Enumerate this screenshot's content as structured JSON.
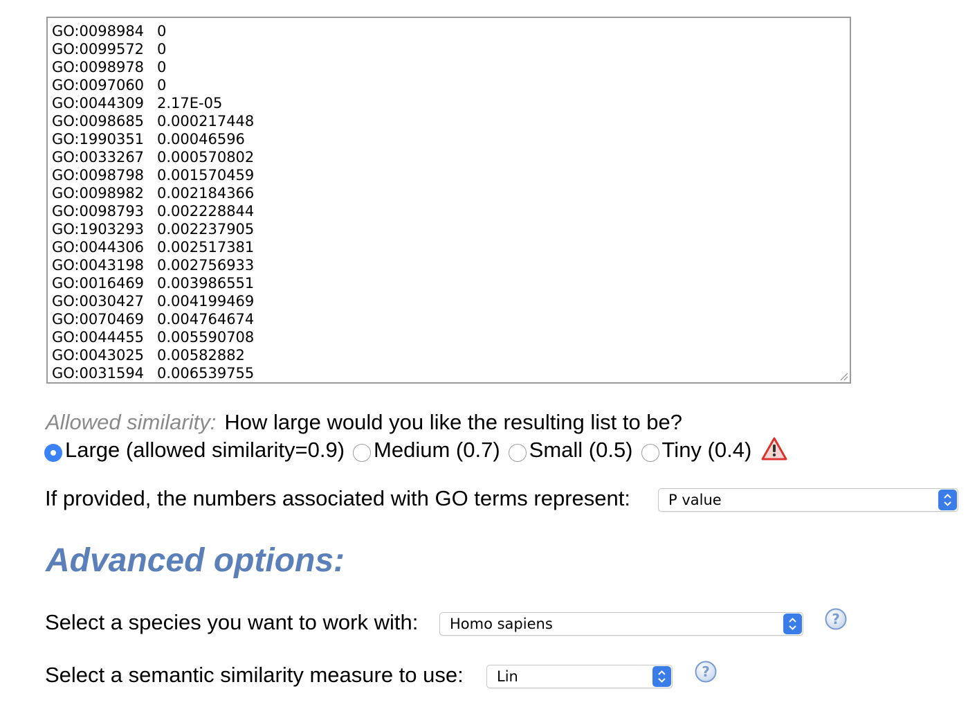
{
  "go_list": {
    "rows": [
      {
        "id": "GO:0098984",
        "value": "0"
      },
      {
        "id": "GO:0099572",
        "value": "0"
      },
      {
        "id": "GO:0098978",
        "value": "0"
      },
      {
        "id": "GO:0097060",
        "value": "0"
      },
      {
        "id": "GO:0044309",
        "value": "2.17E-05"
      },
      {
        "id": "GO:0098685",
        "value": "0.000217448"
      },
      {
        "id": "GO:1990351",
        "value": "0.00046596"
      },
      {
        "id": "GO:0033267",
        "value": "0.000570802"
      },
      {
        "id": "GO:0098798",
        "value": "0.001570459"
      },
      {
        "id": "GO:0098982",
        "value": "0.002184366"
      },
      {
        "id": "GO:0098793",
        "value": "0.002228844"
      },
      {
        "id": "GO:1903293",
        "value": "0.002237905"
      },
      {
        "id": "GO:0044306",
        "value": "0.002517381"
      },
      {
        "id": "GO:0043198",
        "value": "0.002756933"
      },
      {
        "id": "GO:0016469",
        "value": "0.003986551"
      },
      {
        "id": "GO:0030427",
        "value": "0.004199469"
      },
      {
        "id": "GO:0070469",
        "value": "0.004764674"
      },
      {
        "id": "GO:0044455",
        "value": "0.005590708"
      },
      {
        "id": "GO:0043025",
        "value": "0.00582882"
      },
      {
        "id": "GO:0031594",
        "value": "0.006539755"
      }
    ]
  },
  "similarity": {
    "label": "Allowed similarity:",
    "question": "How large would you like the resulting list to be?",
    "options": [
      {
        "label": "Large (allowed similarity=0.9)",
        "checked": true
      },
      {
        "label": "Medium (0.7)",
        "checked": false
      },
      {
        "label": "Small (0.5)",
        "checked": false
      },
      {
        "label": "Tiny (0.4)",
        "checked": false
      }
    ],
    "warning_icon": "warning-triangle-icon"
  },
  "numbers_represent": {
    "label": "If provided, the numbers associated with GO terms represent:",
    "selected": "P value"
  },
  "advanced": {
    "heading": "Advanced options:"
  },
  "species": {
    "label": "Select a species you want to work with:",
    "selected": "Homo sapiens",
    "help_icon": "help-icon"
  },
  "measure": {
    "label": "Select a semantic similarity measure to use:",
    "selected": "Lin",
    "help_icon": "help-icon"
  },
  "colors": {
    "accent": "#3b7de8",
    "heading": "#5a7fb9",
    "muted_label": "#8a8a8a",
    "warning": "#d9342b"
  }
}
